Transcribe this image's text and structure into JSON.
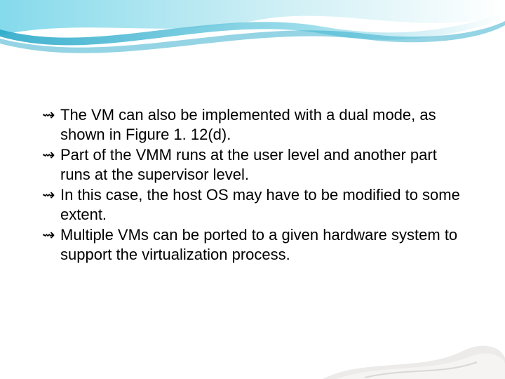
{
  "bullets": {
    "glyph": "⇝",
    "items": [
      "The VM can also be implemented with a dual mode, as shown in Figure 1. 12(d).",
      "Part of the VMM runs at the user level and another part runs at the supervisor level.",
      "In this case, the host OS may have to be modified to some extent.",
      "Multiple VMs can be ported to a given hardware system to support the virtualization process."
    ]
  }
}
